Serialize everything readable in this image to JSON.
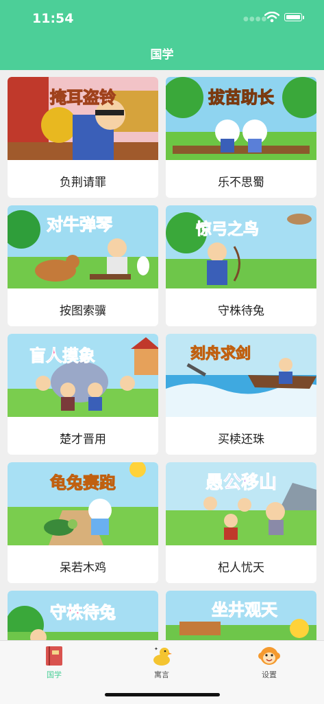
{
  "status_bar": {
    "time": "11:54"
  },
  "nav": {
    "title": "国学"
  },
  "cards": [
    {
      "banner": "掩耳盗铃",
      "label": "负荆请罪"
    },
    {
      "banner": "拔苗助长",
      "label": "乐不思蜀"
    },
    {
      "banner": "对牛弹琴",
      "label": "按图索骥"
    },
    {
      "banner": "惊弓之鸟",
      "label": "守株待兔"
    },
    {
      "banner": "盲人摸象",
      "label": "楚才晋用"
    },
    {
      "banner": "刻舟求剑",
      "label": "买椟还珠"
    },
    {
      "banner": "龟兔赛跑",
      "label": "呆若木鸡"
    },
    {
      "banner": "愚公移山",
      "label": "杞人忧天"
    },
    {
      "banner": "守株待兔",
      "label": ""
    },
    {
      "banner": "坐井观天",
      "label": ""
    }
  ],
  "tabs": [
    {
      "label": "国学",
      "icon": "book-icon",
      "active": true
    },
    {
      "label": "寓言",
      "icon": "duck-icon",
      "active": false
    },
    {
      "label": "设置",
      "icon": "monkey-icon",
      "active": false
    }
  ],
  "colors": {
    "accent": "#4ccf98",
    "background": "#efefef"
  }
}
